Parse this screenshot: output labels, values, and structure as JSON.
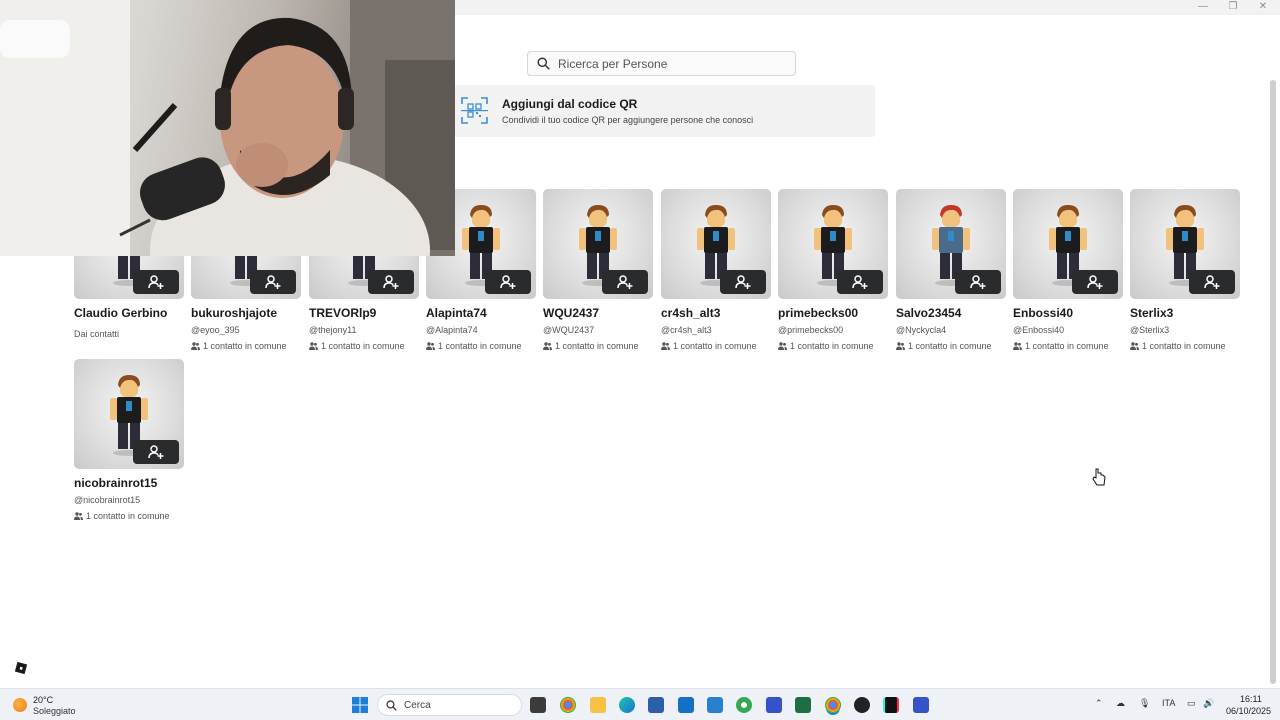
{
  "search": {
    "placeholder": "Ricerca per Persone"
  },
  "qr": {
    "title": "Aggiungi dal codice QR",
    "subtitle": "Condividi il tuo codice QR per aggiungere persone che conosci"
  },
  "cards": [
    {
      "name": "Claudio Gerbino",
      "handle": "",
      "sub": "Dai contatti",
      "avatar": "bacon-hair"
    },
    {
      "name": "bukuroshjajote",
      "handle": "@eyoo_395",
      "sub": "1 contatto in comune",
      "avatar": "bacon-hair"
    },
    {
      "name": "TREVORlp9",
      "handle": "@thejony11",
      "sub": "1 contatto in comune",
      "avatar": "bacon-hair"
    },
    {
      "name": "Alapinta74",
      "handle": "@Alapinta74",
      "sub": "1 contatto in comune",
      "avatar": "bacon-hair"
    },
    {
      "name": "WQU2437",
      "handle": "@WQU2437",
      "sub": "1 contatto in comune",
      "avatar": "bacon-hair"
    },
    {
      "name": "cr4sh_alt3",
      "handle": "@cr4sh_alt3",
      "sub": "1 contatto in comune",
      "avatar": "bacon-hair"
    },
    {
      "name": "primebecks00",
      "handle": "@primebecks00",
      "sub": "1 contatto in comune",
      "avatar": "bacon-hair"
    },
    {
      "name": "Salvo23454",
      "handle": "@Nyckycla4",
      "sub": "1 contatto in comune",
      "avatar": "red-cap"
    },
    {
      "name": "Enbossi40",
      "handle": "@Enbossi40",
      "sub": "1 contatto in comune",
      "avatar": "bacon-hair"
    },
    {
      "name": "Sterlix3",
      "handle": "@Sterlix3",
      "sub": "1 contatto in comune",
      "avatar": "bacon-hair"
    },
    {
      "name": "nicobrainrot15",
      "handle": "@nicobrainrot15",
      "sub": "1 contatto in comune",
      "avatar": "bacon-hair"
    }
  ],
  "taskbar": {
    "weather_temp": "20°C",
    "weather_desc": "Soleggiato",
    "search_label": "Cerca",
    "language": "ITA",
    "time": "16:11",
    "date": "06/10/2025"
  },
  "colors": {
    "add_button": "#2a2b2d",
    "qr_accent": "#3b8fd9",
    "banner_bg": "#f2f2f3"
  }
}
